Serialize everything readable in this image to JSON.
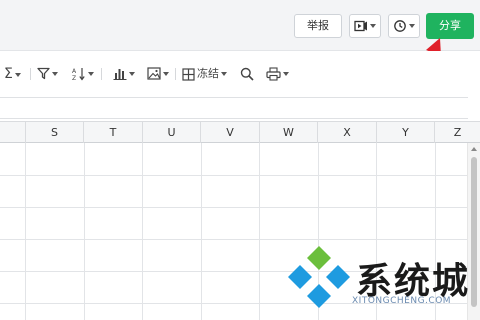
{
  "header": {
    "report_label": "举报",
    "share_label": "分享"
  },
  "toolbar": {
    "freeze_label": "冻结"
  },
  "columns": [
    "S",
    "T",
    "U",
    "V",
    "W",
    "X",
    "Y",
    "Z"
  ],
  "watermark": {
    "brand": "系统城",
    "site": "XITONGCHENG.COM"
  },
  "colors": {
    "share_button": "#1fb35f",
    "annotation_arrow": "#e0202a",
    "logo_blue": "#1e9be0",
    "logo_green": "#6bbf3c"
  }
}
